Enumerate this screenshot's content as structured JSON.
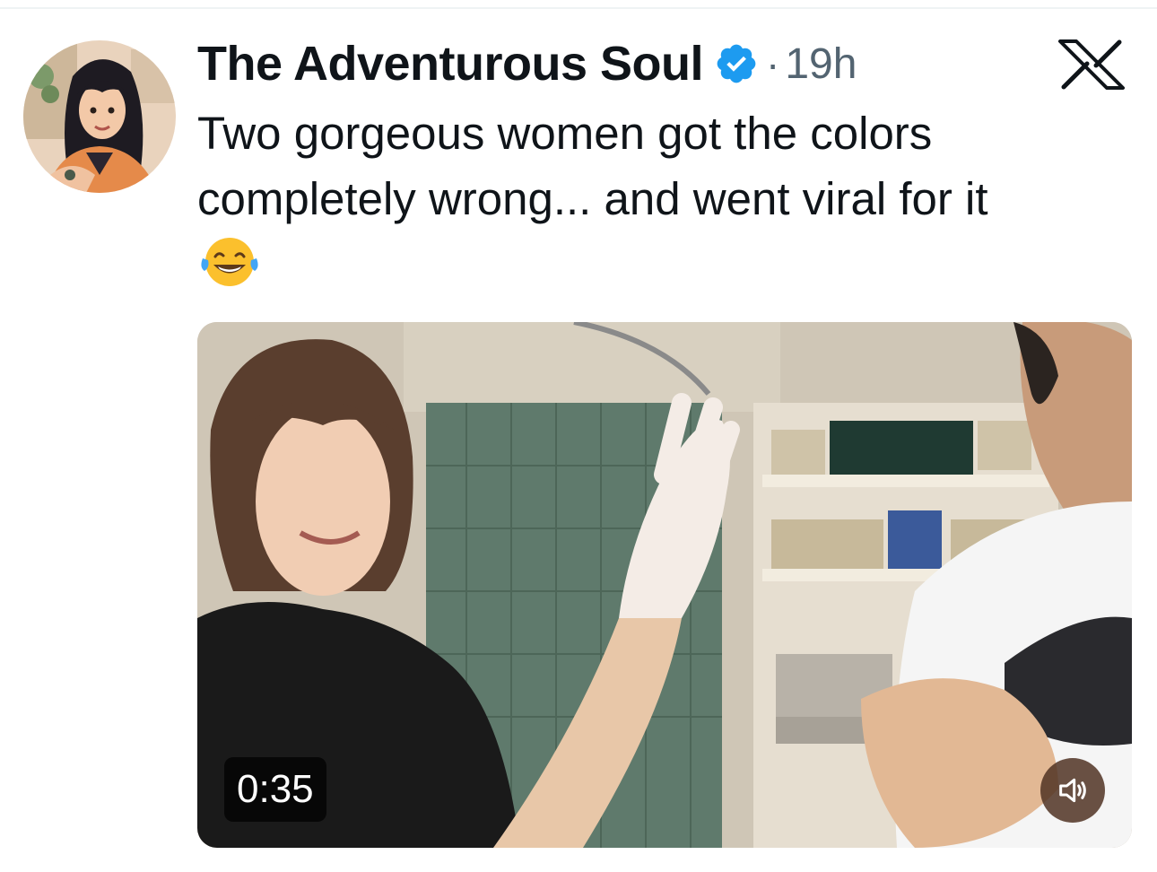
{
  "tweet": {
    "author_name": "The Adventurous Soul",
    "separator": "·",
    "time": "19h",
    "text": "Two gorgeous women got the colors completely wrong... and went viral for it",
    "emoji": "face-with-tears-of-joy",
    "verified": true
  },
  "media": {
    "type": "video",
    "duration": "0:35",
    "muted": true
  },
  "colors": {
    "verified_blue": "#1d9bf0",
    "text_primary": "#0f1419",
    "text_secondary": "#536471"
  }
}
